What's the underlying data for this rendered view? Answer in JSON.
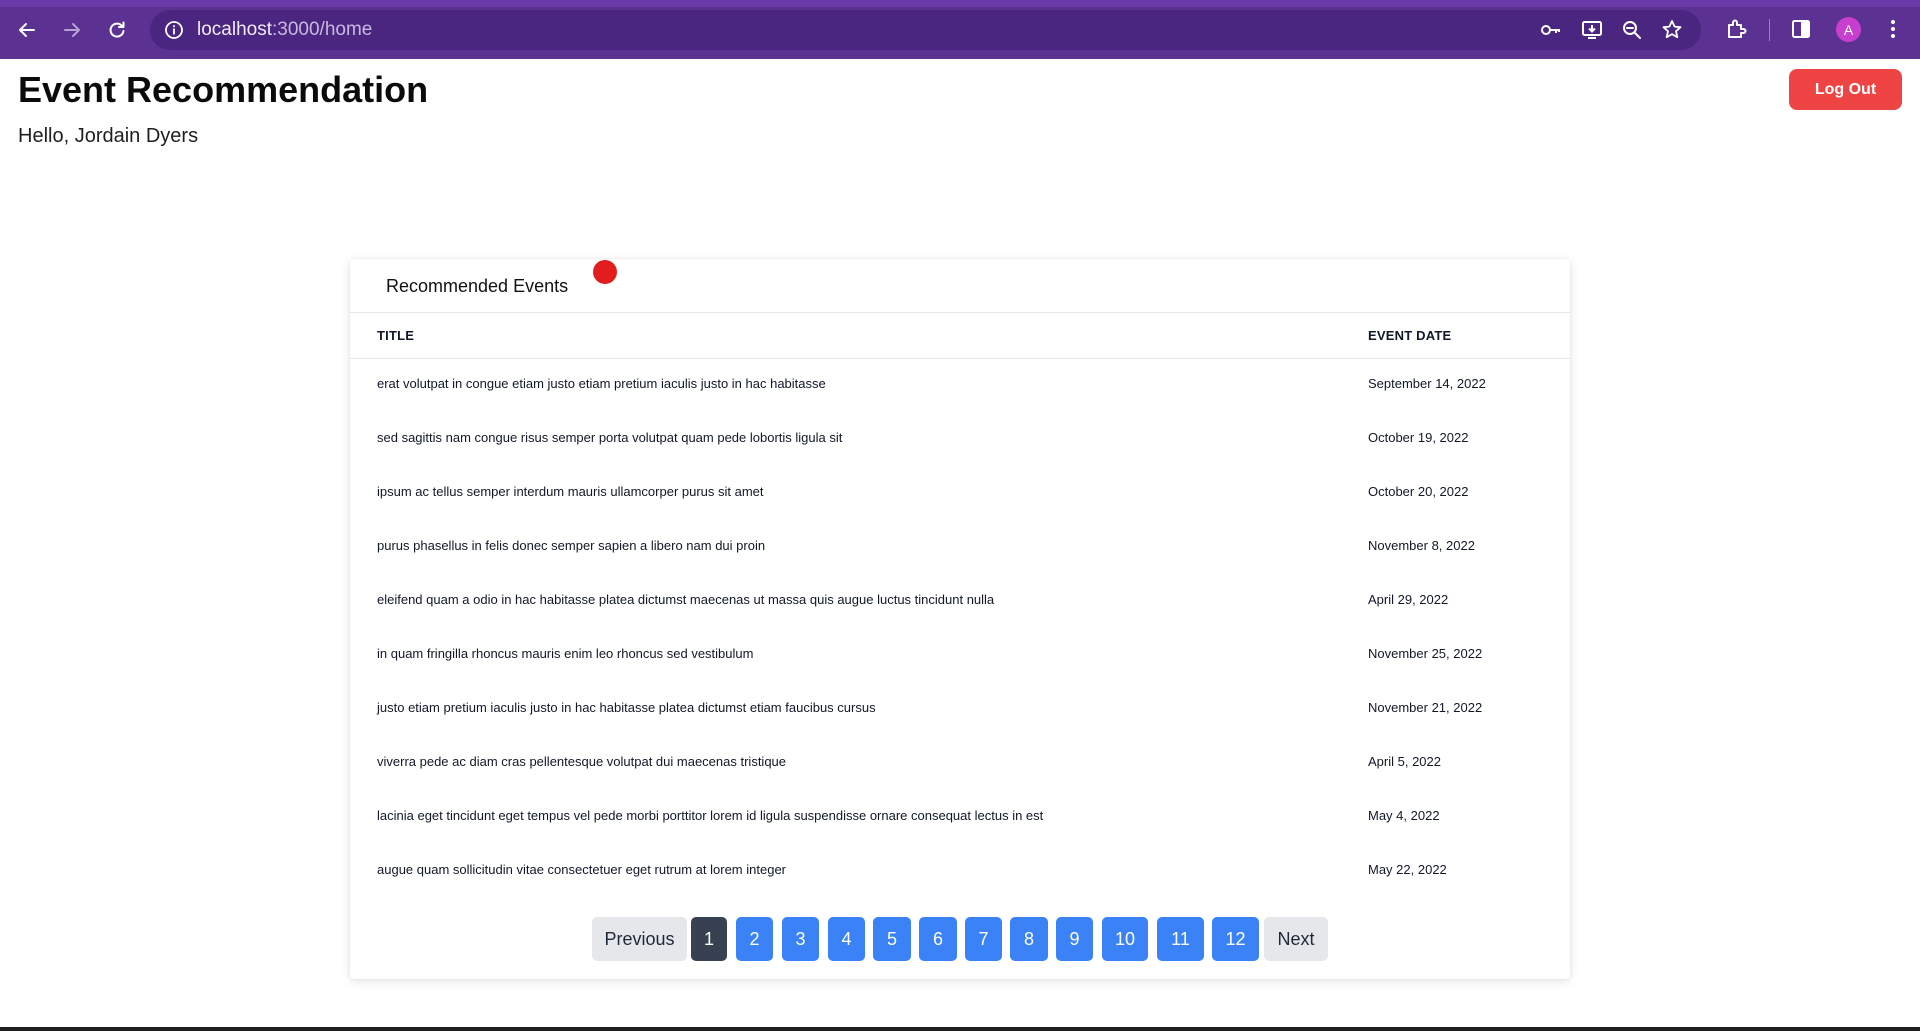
{
  "browser": {
    "url_host": "localhost",
    "url_path": ":3000/home",
    "profile_initial": "A",
    "theme_color": "#5b3191"
  },
  "header": {
    "title": "Event Recommendation",
    "greeting": "Hello, Jordain Dyers",
    "logout_label": "Log Out",
    "logout_color": "#ef4444"
  },
  "card": {
    "title": "Recommended Events",
    "columns": [
      "TITLE",
      "EVENT DATE"
    ],
    "rows": [
      {
        "title": "erat volutpat in congue etiam justo etiam pretium iaculis justo in hac habitasse",
        "date": "September 14, 2022"
      },
      {
        "title": "sed sagittis nam congue risus semper porta volutpat quam pede lobortis ligula sit",
        "date": "October 19, 2022"
      },
      {
        "title": "ipsum ac tellus semper interdum mauris ullamcorper purus sit amet",
        "date": "October 20, 2022"
      },
      {
        "title": "purus phasellus in felis donec semper sapien a libero nam dui proin",
        "date": "November 8, 2022"
      },
      {
        "title": "eleifend quam a odio in hac habitasse platea dictumst maecenas ut massa quis augue luctus tincidunt nulla",
        "date": "April 29, 2022"
      },
      {
        "title": "in quam fringilla rhoncus mauris enim leo rhoncus sed vestibulum",
        "date": "November 25, 2022"
      },
      {
        "title": "justo etiam pretium iaculis justo in hac habitasse platea dictumst etiam faucibus cursus",
        "date": "November 21, 2022"
      },
      {
        "title": "viverra pede ac diam cras pellentesque volutpat dui maecenas tristique",
        "date": "April 5, 2022"
      },
      {
        "title": "lacinia eget tincidunt eget tempus vel pede morbi porttitor lorem id ligula suspendisse ornare consequat lectus in est",
        "date": "May 4, 2022"
      },
      {
        "title": "augue quam sollicitudin vitae consectetuer eget rutrum at lorem integer",
        "date": "May 22, 2022"
      }
    ]
  },
  "pagination": {
    "previous_label": "Previous",
    "next_label": "Next",
    "pages": [
      "1",
      "2",
      "3",
      "4",
      "5",
      "6",
      "7",
      "8",
      "9",
      "10",
      "11",
      "12"
    ],
    "current_page": "1",
    "page_color": "#3b82f6",
    "active_color": "#374151"
  }
}
